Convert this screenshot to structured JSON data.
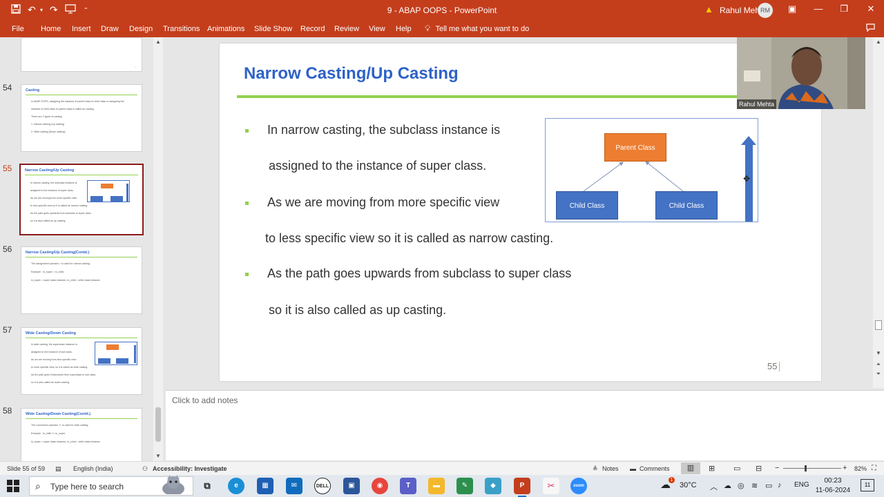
{
  "window": {
    "title": "9 - ABAP OOPS  -  PowerPoint",
    "user_name": "Rahul Mehta",
    "user_initials": "RM"
  },
  "menu": {
    "tabs": [
      "File",
      "Home",
      "Insert",
      "Draw",
      "Design",
      "Transitions",
      "Animations",
      "Slide Show",
      "Record",
      "Review",
      "View",
      "Help"
    ],
    "tell_me": "Tell me what you want to do"
  },
  "thumbnails": [
    {
      "number": "54",
      "title": "Casting",
      "bullets": [
        "In ABAP OOPS, assigning the instance of parent class to child class or assigning the",
        "instance of child class to parent class is called as casting.",
        "There are 2 types of casting.",
        "1.  Narrow casting (Up casting)",
        "2.  Wide casting (Down casting)"
      ]
    },
    {
      "number": "55",
      "title": "Narrow Casting/Up Casting",
      "bullets": [
        "In narrow casting, the subclass instance is",
        "assigned to the instance of super class.",
        "As we are moving from more specific view",
        "to less specific view so it is called as narrow casting.",
        "As the path goes upwards from subclass to super class",
        "so it is also called as up casting."
      ]
    },
    {
      "number": "56",
      "title": "Narrow Casting/Up Casting(Contd.)",
      "bullets": [
        "The assignment operator = is used for narrow casting.",
        "Example : lo_super = lo_child.",
        "lo_super = super class instance, lo_child = child class instance"
      ]
    },
    {
      "number": "57",
      "title": "Wide Casting/Down Casting",
      "bullets": [
        "In wide casting, the superclass instance is",
        "assigned to the instance of sub class.",
        "As we are moving from less specific view",
        "to more specific view, so it is called as wide casting.",
        "As the path goes Downwards from superclass to sub class,",
        "so it is also called as down casting."
      ]
    },
    {
      "number": "58",
      "title": "Wide Casting/Down Casting(Contd.)",
      "bullets": [
        "The conversion operator ?= is used for wide casting.",
        "Example : lo_child ?= lo_super.",
        "lo_super = super class instance, lo_child = child class instance"
      ]
    }
  ],
  "slide": {
    "title": "Narrow Casting/Up Casting",
    "bullets": [
      {
        "line1": "In narrow casting, the subclass instance is",
        "line2": "assigned to the instance of super class."
      },
      {
        "line1": "As we are moving from more specific view",
        "line2": "to less specific view so it is called as narrow casting."
      },
      {
        "line1": "As the path goes upwards from subclass to super class",
        "line2": "so it is also called as up casting."
      }
    ],
    "diagram": {
      "parent": "Parent Class",
      "child1": "Child Class",
      "child2": "Child Class"
    },
    "page_number": "55",
    "colors": {
      "title": "#2e62c7",
      "accent_line": "#92d050",
      "parent_box": "#ed7d31",
      "child_box": "#4472c4",
      "arrow": "#4472c4"
    }
  },
  "webcam": {
    "label": "Rahul Mehta"
  },
  "notes": {
    "placeholder": "Click to add notes"
  },
  "status": {
    "slide_info": "Slide 55 of 59",
    "language": "English (India)",
    "accessibility": "Accessibility: Investigate",
    "notes_btn": "Notes",
    "comments_btn": "Comments",
    "zoom": "82%"
  },
  "taskbar": {
    "search_placeholder": "Type here to search",
    "weather_temp": "30°C",
    "language": "ENG",
    "time": "00:23",
    "date": "11-06-2024",
    "notification_count": "11",
    "warning_badge": "1"
  }
}
